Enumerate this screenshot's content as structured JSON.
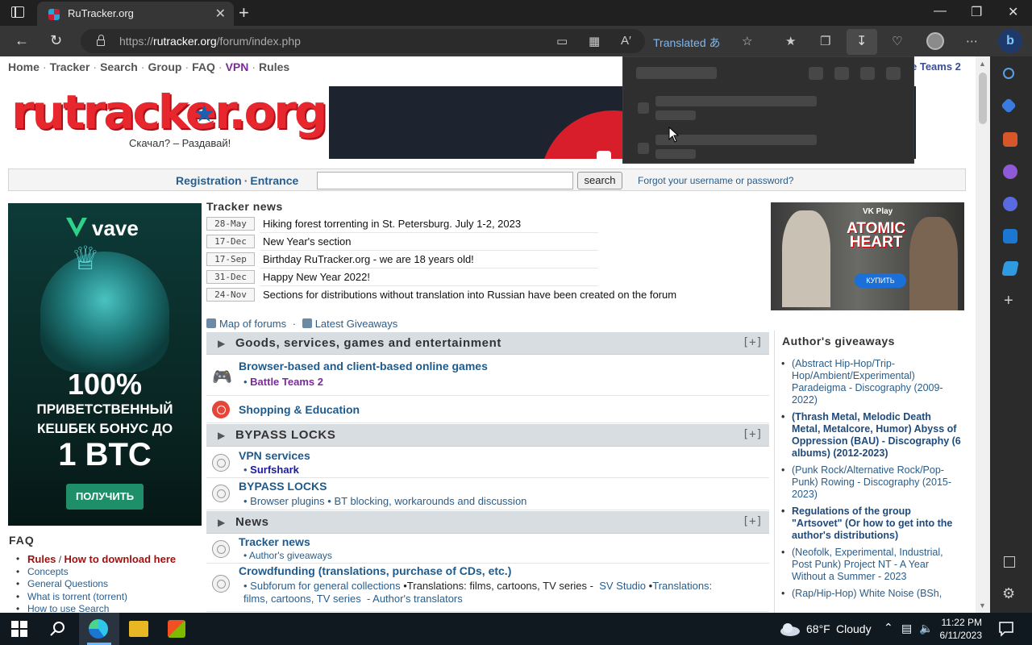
{
  "browser": {
    "tab_title": "RuTracker.org",
    "tab_close": "✕",
    "new_tab": "+",
    "url_prefix": "https://",
    "url_host": "rutracker.org",
    "url_path": "/forum/index.php",
    "translated_label": "Translated",
    "translate_glyph": "あ"
  },
  "site": {
    "nav": [
      "Home",
      "Tracker",
      "Search",
      "Group",
      "FAQ",
      "VPN",
      "Rules"
    ],
    "nav_right": "e Teams 2",
    "logo_text": "rutracker.org",
    "slogan": "Скачал? – Раздавай!",
    "registration": "Registration",
    "entrance": "Entrance",
    "search_button": "search",
    "forgot": "Forgot your username or password?"
  },
  "left_ad": {
    "brand": "vave",
    "line1": "100%",
    "line2": "ПРИВЕТСТВЕННЫЙ",
    "line3": "КЕШБЕК БОНУС ДО",
    "line4": "1 BTC",
    "button": "ПОЛУЧИТЬ"
  },
  "right_ad": {
    "brand": "VK Play",
    "title1": "ATOMIC",
    "title2": "HEART",
    "button": "КУПИТЬ"
  },
  "faq": {
    "title": "FAQ",
    "rules": "Rules",
    "slash": "/",
    "how_to": "How to download here",
    "items": [
      "Concepts",
      "General Questions",
      "What is torrent (torrent)",
      "How to use Search"
    ]
  },
  "tracker_news": {
    "title": "Tracker news",
    "items": [
      {
        "date": "28-May",
        "text": "Hiking forest torrenting in St. Petersburg. July 1-2, 2023"
      },
      {
        "date": "17-Dec",
        "text": "New Year's section"
      },
      {
        "date": "17-Sep",
        "text": "Birthday RuTracker.org - we are 18 years old!"
      },
      {
        "date": "31-Dec",
        "text": "Happy New Year 2022!"
      },
      {
        "date": "24-Nov",
        "text": "Sections for distributions without translation into Russian have been created on the forum"
      }
    ]
  },
  "links": {
    "map": "Map of forums",
    "latest": "Latest Giveaways"
  },
  "categories": {
    "goods": "Goods, services, games and entertainment",
    "bypass": "BYPASS LOCKS",
    "news": "News",
    "plus": "[+]"
  },
  "forums": {
    "games": "Browser-based and client-based online games",
    "games_sub": "Battle Teams 2",
    "shop": "Shopping & Education",
    "vpn": "VPN services",
    "vpn_sub": "Surfshark",
    "bypass": "BYPASS LOCKS",
    "bypass_sub1": "Browser plugins",
    "bypass_sub2": "BT blocking, workarounds and discussion",
    "news": "Tracker news",
    "news_sub": "Author's giveaways",
    "crowd": "Crowdfunding (translations, purchase of CDs, etc.)",
    "crowd_sub1": "Subforum for general collections",
    "crowd_sub2": "Translations: films, cartoons, TV series -",
    "crowd_sub3": "SV Studio",
    "crowd_sub4": "Translations:",
    "crowd_sub5": "films, cartoons, TV series",
    "crowd_sub6": "- Author's translators"
  },
  "giveaways": {
    "title": "Author's giveaways",
    "items": [
      "(Abstract Hip-Hop/Trip-Hop/Ambient/Experimental) Paradeigma - Discography (2009-2022)",
      "(Thrash Metal, Melodic Death Metal, Metalcore, Humor) Abyss of Oppression (BAU) - Discography (6 albums) (2012-2023)",
      "(Punk Rock/Alternative Rock/Pop-Punk) Rowing - Discography (2015-2023)",
      "Regulations of the group \"Artsovet\" (Or how to get into the author's distributions)",
      "(Neofolk, Experimental, Industrial, Post Punk) Project NT - A Year Without a Summer - 2023",
      "(Rap/Hip-Hop) White Noise (BSh,"
    ]
  },
  "taskbar": {
    "temp": "68°F",
    "weather": "Cloudy",
    "time": "11:22 PM",
    "date": "6/11/2023"
  },
  "colors": {
    "link": "#2a5d8a",
    "accent_red": "#e8262d",
    "category_bg": "#d8dde2",
    "chrome_dark": "#202020"
  }
}
